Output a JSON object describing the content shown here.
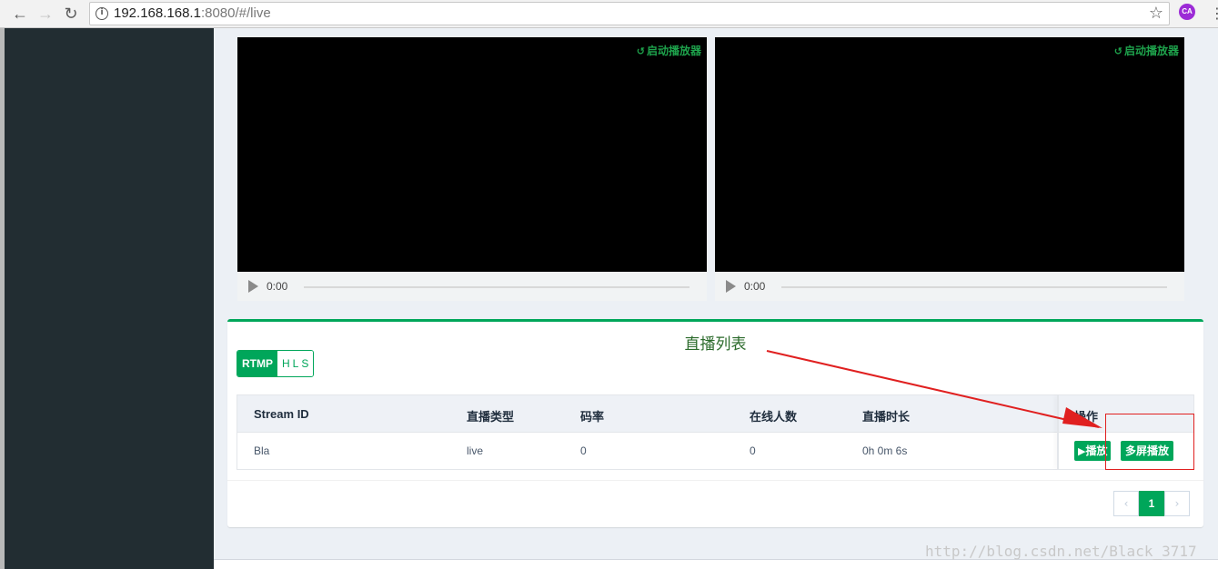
{
  "browser": {
    "url_host": "192.168.168.1",
    "url_rest": ":8080/#/live",
    "extension_label": "CA"
  },
  "players": [
    {
      "restart_label": "启动播放器",
      "time": "0:00"
    },
    {
      "restart_label": "启动播放器",
      "time": "0:00"
    }
  ],
  "live_list": {
    "title": "直播列表",
    "protocols": [
      "RTMP",
      "HLS"
    ],
    "active_protocol": "RTMP",
    "columns": [
      "Stream ID",
      "直播类型",
      "码率",
      "在线人数",
      "直播时长",
      "操作"
    ],
    "rows": [
      {
        "stream_id": "Bla",
        "type": "live",
        "bitrate": "0",
        "online": "0",
        "duration": "0h 0m 6s",
        "play_label": "播放",
        "multi_label": "多屏播放"
      }
    ],
    "pagination": {
      "current_page": "1",
      "prev_icon": "chevron-left-icon",
      "next_icon": "chevron-right-icon"
    }
  },
  "watermark": "http://blog.csdn.net/Black_3717",
  "colors": {
    "accent": "#00a65a",
    "sidebar": "#222d32",
    "annotation": "#e02020"
  }
}
